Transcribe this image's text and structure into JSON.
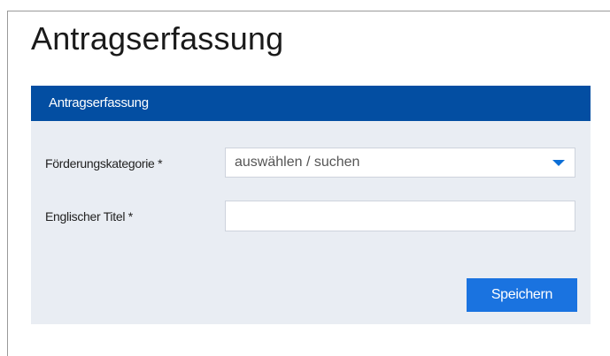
{
  "page": {
    "title": "Antragserfassung"
  },
  "panel": {
    "header": "Antragserfassung",
    "fields": {
      "category": {
        "label": "Förderungskategorie *",
        "value": "auswählen / suchen"
      },
      "english_title": {
        "label": "Englischer Titel *",
        "value": ""
      }
    },
    "save_label": "Speichern"
  },
  "colors": {
    "header_bg": "#034ea2",
    "panel_bg": "#e9edf3",
    "button_bg": "#1a73e0",
    "dropdown_arrow": "#0c6ed6"
  },
  "icons": {
    "select_arrow": "chevron-down-icon"
  }
}
